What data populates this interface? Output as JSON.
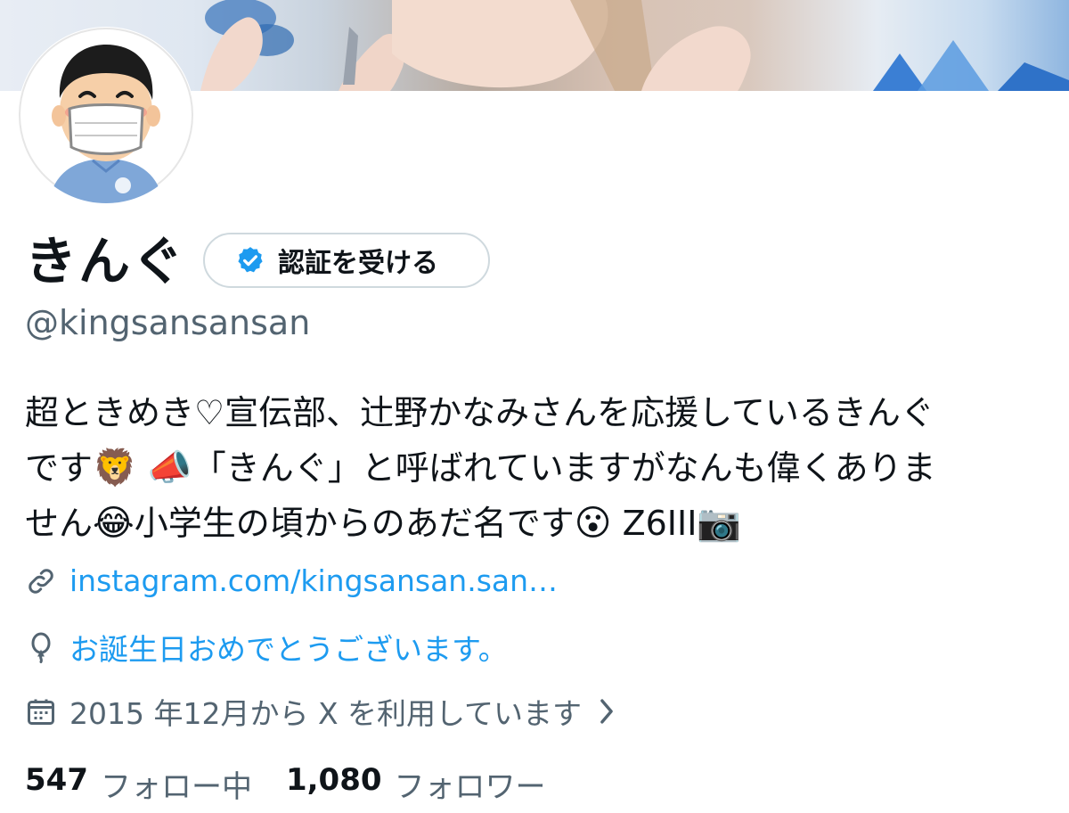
{
  "profile": {
    "display_name": "きんぐ",
    "verify_button_label": "認証を受ける",
    "handle": "@kingsansansan",
    "bio_lines": [
      "超ときめき♡宣伝部、辻野かなみさんを応援しているきんぐ",
      "です",
      "「きんぐ」と呼ばれていますがなんも偉くありま",
      "せん",
      "小学生の頃からのあだ名です",
      "Z6III"
    ],
    "bio_emojis": [
      "🦁",
      "📣",
      "😂",
      "😮",
      "📷"
    ],
    "link": "instagram.com/kingsansan.san…",
    "birthday": "お誕生日おめでとうございます。",
    "joined": "2015 年12月から X を利用しています",
    "following_count": "547",
    "following_label": "フォロー中",
    "followers_count": "1,080",
    "followers_label": "フォロワー"
  },
  "icons": {
    "verify": "verified-badge-icon",
    "link": "link-icon",
    "birthday": "balloon-icon",
    "joined": "calendar-icon",
    "chevron": "chevron-right-icon"
  },
  "colors": {
    "accent": "#1d9bf0",
    "secondary_text": "#536471",
    "primary_text": "#0f1419",
    "border": "#cfd9de"
  }
}
